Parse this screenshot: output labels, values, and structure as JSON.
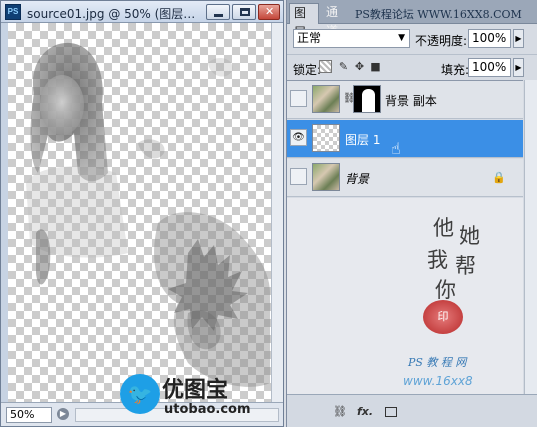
{
  "document": {
    "app_icon": "PS",
    "title": "source01.jpg @ 50% (图层…",
    "zoom": "50%"
  },
  "panel": {
    "tabs": [
      "图层",
      "通道"
    ],
    "watermark_top": "PS教程论坛 WWW.16XX8.COM",
    "blend_mode": "正常",
    "opacity_label": "不透明度:",
    "opacity_value": "100%",
    "lock_label": "锁定:",
    "fill_label": "填充:",
    "fill_value": "100%",
    "layers": [
      {
        "name": "背景 副本",
        "visible": false,
        "has_mask": true,
        "locked": false,
        "selected": false
      },
      {
        "name": "图层 1",
        "visible": true,
        "has_mask": false,
        "locked": false,
        "selected": true
      },
      {
        "name": "背景",
        "visible": false,
        "has_mask": false,
        "locked": true,
        "selected": false
      }
    ]
  },
  "artwork": {
    "calligraphy": [
      "他",
      "她",
      "我",
      "帮",
      "你"
    ],
    "seal_text": "印",
    "site_text": "PS 教 程 网",
    "url_text": "www.16xx8"
  },
  "brand": {
    "cn": "优图宝",
    "en": "utobao.com"
  },
  "icons": {
    "eye": "eye-icon",
    "chain": "chain-link-icon",
    "lock": "lock-icon",
    "cursor": "hand-pointer-icon"
  }
}
